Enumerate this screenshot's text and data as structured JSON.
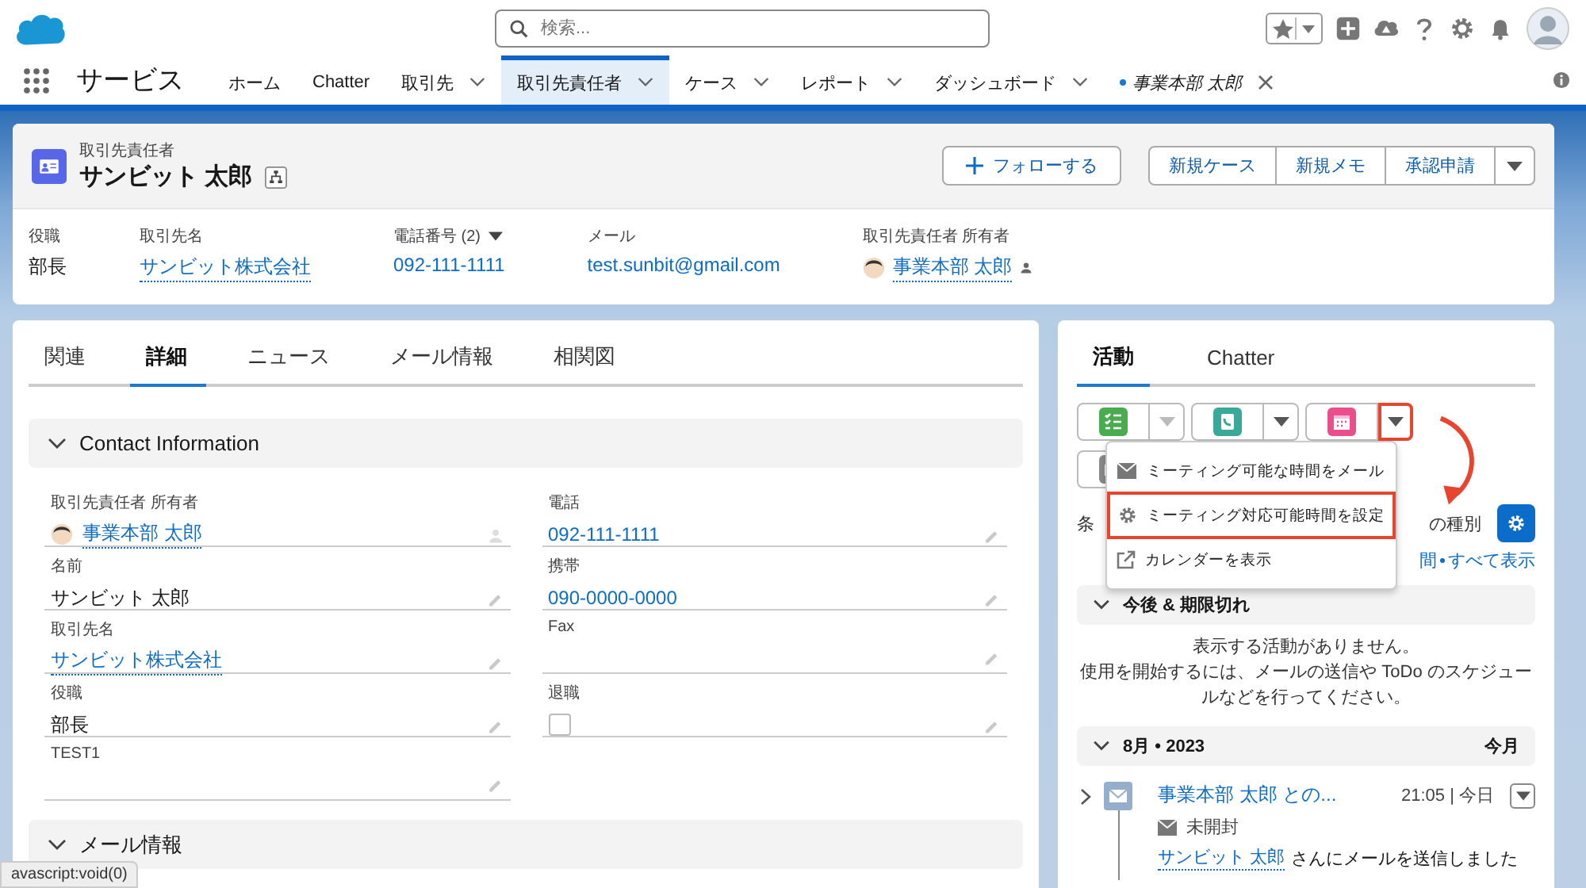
{
  "header": {
    "search": {
      "placeholder": "検索..."
    }
  },
  "nav": {
    "app_name": "サービス",
    "tabs": [
      {
        "label": "ホーム",
        "selected": false,
        "menu": false,
        "kind": "page"
      },
      {
        "label": "Chatter",
        "selected": false,
        "menu": false,
        "kind": "page"
      },
      {
        "label": "取引先",
        "selected": false,
        "menu": true,
        "kind": "page"
      },
      {
        "label": "取引先責任者",
        "selected": true,
        "menu": true,
        "kind": "page"
      },
      {
        "label": "ケース",
        "selected": false,
        "menu": true,
        "kind": "page"
      },
      {
        "label": "レポート",
        "selected": false,
        "menu": true,
        "kind": "page"
      },
      {
        "label": "ダッシュボード",
        "selected": false,
        "menu": true,
        "kind": "page"
      },
      {
        "label": "事業本部 太郎",
        "selected": false,
        "menu": false,
        "kind": "record"
      }
    ]
  },
  "record": {
    "object_label": "取引先責任者",
    "name": "サンビット 太郎",
    "follow_button": "フォローする",
    "actions": [
      "新規ケース",
      "新規メモ",
      "承認申請"
    ],
    "highlights": [
      {
        "label": "役職",
        "value": "部長",
        "kind": "text"
      },
      {
        "label": "取引先名",
        "value": "サンビット株式会社",
        "kind": "link"
      },
      {
        "label": "電話番号 (2)",
        "value": "092-111-1111",
        "kind": "phone"
      },
      {
        "label": "メール",
        "value": "test.sunbit@gmail.com",
        "kind": "plain-link"
      },
      {
        "label": "取引先責任者 所有者",
        "value": "事業本部 太郎",
        "kind": "user"
      }
    ]
  },
  "detail": {
    "tabs": [
      {
        "label": "関連",
        "selected": false
      },
      {
        "label": "詳細",
        "selected": true
      },
      {
        "label": "ニュース",
        "selected": false
      },
      {
        "label": "メール情報",
        "selected": false
      },
      {
        "label": "相関図",
        "selected": false
      }
    ],
    "sections": [
      {
        "title": "Contact Information",
        "expanded": true,
        "left": [
          {
            "label": "取引先責任者 所有者",
            "value": "事業本部 太郎",
            "kind": "user"
          },
          {
            "label": "名前",
            "value": "サンビット 太郎",
            "kind": "text"
          },
          {
            "label": "取引先名",
            "value": "サンビット株式会社",
            "kind": "link"
          },
          {
            "label": "役職",
            "value": "部長",
            "kind": "text"
          },
          {
            "label": "TEST1",
            "kind": "text"
          }
        ],
        "right": [
          {
            "label": "電話",
            "value": "092-111-1111",
            "kind": "plain-link"
          },
          {
            "label": "携帯",
            "value": "090-0000-0000",
            "kind": "plain-link"
          },
          {
            "label": "Fax",
            "kind": "text"
          },
          {
            "label": "退職",
            "kind": "checkbox",
            "checked": false
          }
        ]
      },
      {
        "title": "メール情報",
        "expanded": true
      }
    ]
  },
  "activity": {
    "tabs": [
      {
        "label": "活動",
        "selected": true
      },
      {
        "label": "Chatter",
        "selected": false
      }
    ],
    "actions": [
      {
        "kind": "task",
        "color": "#4bab4f",
        "highlighted": false
      },
      {
        "kind": "call",
        "color": "#3aa99a",
        "highlighted": false
      },
      {
        "kind": "event",
        "color": "#ea4f8b",
        "highlighted": true
      }
    ],
    "email_action": {
      "kind": "email",
      "color": "#8a8a8a"
    },
    "menu": [
      {
        "label": "ミーティング可能な時間をメール",
        "kind": "email",
        "highlighted": false
      },
      {
        "label": "ミーティング対応可能時間を設定",
        "kind": "gear",
        "highlighted": true
      },
      {
        "label": "カレンダーを表示",
        "kind": "external",
        "highlighted": false
      }
    ],
    "filter_left": "条",
    "filter_right": "の種別",
    "links_left": "間",
    "show_all": "すべて表示",
    "upcoming": {
      "title": "今後 & 期限切れ",
      "expanded": true,
      "empty_title": "表示する活動がありません。",
      "empty_text": "使用を開始するには、メールの送信や ToDo のスケジュールなどを行ってください。"
    },
    "month": {
      "title": "8月 • 2023",
      "expanded": true,
      "badge": "今月",
      "items": [
        {
          "title": "事業本部 太郎 との...",
          "time": "21:05 | 今日",
          "status": "未開封",
          "recipient": "サンビット 太郎",
          "message": "さんにメールを送信しました",
          "expanded": false
        }
      ]
    }
  },
  "status_bar": "avascript:void(0)"
}
